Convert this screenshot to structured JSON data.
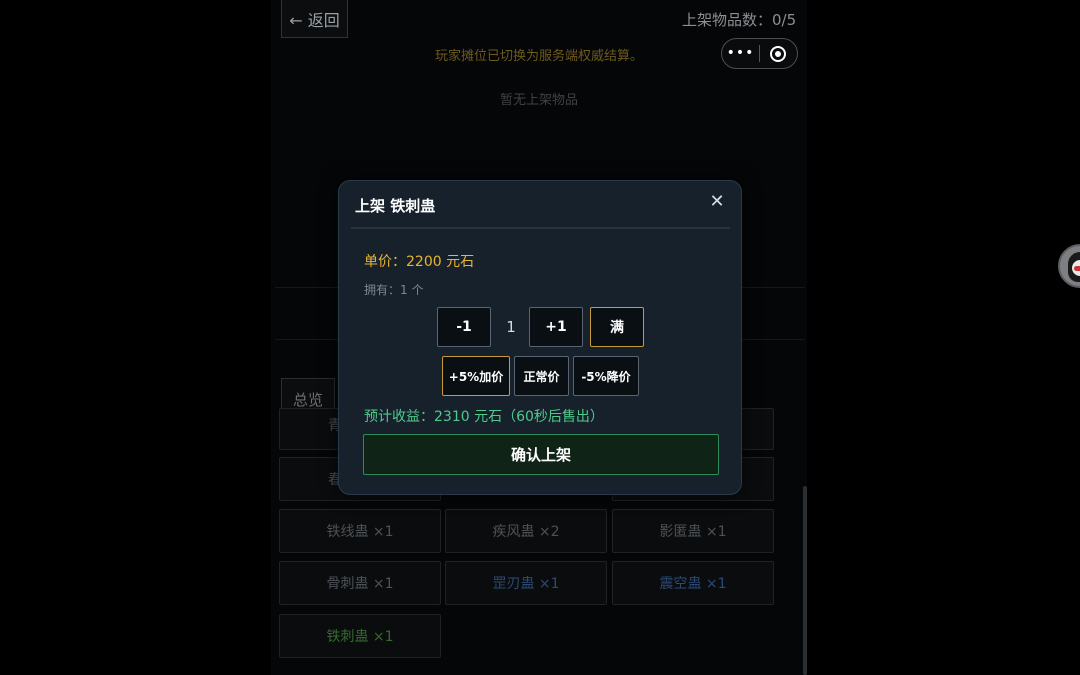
{
  "header": {
    "back_label": "← 返回",
    "listed_count_label": "上架物品数：0/5"
  },
  "capsule": {
    "more_glyph": "•••"
  },
  "notice": "玩家摊位已切换为服务端权威结算。",
  "empty_note": "暂无上架物品",
  "tabs": {
    "overview_label": "总览"
  },
  "inventory": [
    {
      "label": "铁线蛊 ×1",
      "color": "#4d5256"
    },
    {
      "label": "疾风蛊 ×2",
      "color": "#4d5256"
    },
    {
      "label": "影匿蛊 ×1",
      "color": "#4d5256"
    },
    {
      "label": "骨刺蛊 ×1",
      "color": "#4d5256"
    },
    {
      "label": "罡刃蛊 ×1",
      "color": "#2b4a75"
    },
    {
      "label": "震空蛊 ×1",
      "color": "#2b4a75"
    },
    {
      "label": "铁刺蛊 ×1",
      "color": "#356a2c"
    }
  ],
  "inventory_partial": {
    "row_a_first_glyph": "青",
    "row_b_first_glyph": "春"
  },
  "modal": {
    "title": "上架 铁刺蛊",
    "close_glyph": "✕",
    "price_label": "单价：2200 元石",
    "owned_label": "拥有：1 个",
    "qty_minus": "-1",
    "qty_value": "1",
    "qty_plus": "+1",
    "qty_max": "满",
    "price_up": "+5%加价",
    "price_normal": "正常价",
    "price_down": "-5%降价",
    "revenue_label": "预计收益：2310 元石（60秒后售出）",
    "confirm_label": "确认上架"
  },
  "colors": {
    "accent_gold": "#e9b531",
    "accent_green": "#4fca8a",
    "modal_bg": "#17212c"
  }
}
